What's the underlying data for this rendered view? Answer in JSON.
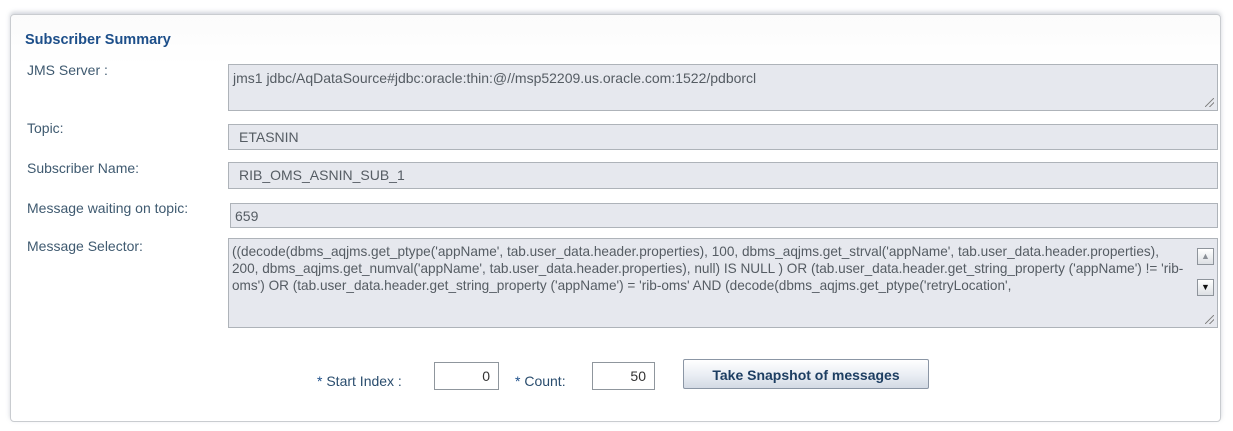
{
  "panel": {
    "title": "Subscriber Summary"
  },
  "fields": {
    "jms_server": {
      "label": "JMS Server :",
      "value": "jms1   jdbc/AqDataSource#jdbc:oracle:thin:@//msp52209.us.oracle.com:1522/pdborcl"
    },
    "topic": {
      "label": "Topic:",
      "value": "ETASNIN"
    },
    "subscriber_name": {
      "label": "Subscriber Name:",
      "value": "RIB_OMS_ASNIN_SUB_1"
    },
    "message_waiting": {
      "label": "Message waiting on topic:",
      "value": "659"
    },
    "message_selector": {
      "label": "Message Selector:",
      "value": "((decode(dbms_aqjms.get_ptype('appName', tab.user_data.header.properties), 100, dbms_aqjms.get_strval('appName', tab.user_data.header.properties), 200, dbms_aqjms.get_numval('appName', tab.user_data.header.properties), null) IS NULL ) OR (tab.user_data.header.get_string_property ('appName')  != 'rib-oms') OR (tab.user_data.header.get_string_property ('appName')  = 'rib-oms' AND (decode(dbms_aqjms.get_ptype('retryLocation',"
    }
  },
  "controls": {
    "required_marker": "*",
    "start_index_label": " Start Index :",
    "start_index_value": "0",
    "count_label": " Count:",
    "count_value": "50",
    "snapshot_button": "Take Snapshot of messages"
  },
  "icons": {
    "scroll_up": "▲",
    "scroll_down": "▼"
  }
}
